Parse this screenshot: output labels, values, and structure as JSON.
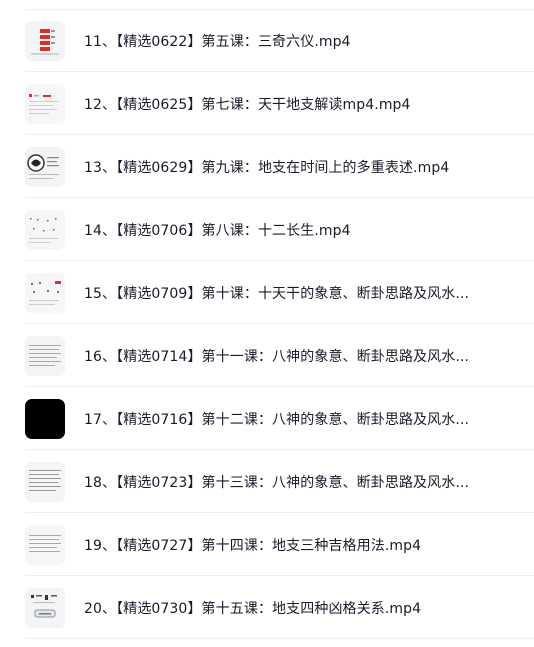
{
  "files": [
    {
      "title": "11、【精选0622】第五课：三奇六仪.mp4",
      "icon": "video-thumbnail"
    },
    {
      "title": "12、【精选0625】第七课：天干地支解读mp4.mp4",
      "icon": "video-thumbnail"
    },
    {
      "title": "13、【精选0629】第九课：地支在时间上的多重表述.mp4",
      "icon": "video-thumbnail"
    },
    {
      "title": "14、【精选0706】第八课：十二长生.mp4",
      "icon": "video-thumbnail"
    },
    {
      "title": "15、【精选0709】第十课：十天干的象意、断卦思路及风水...",
      "icon": "video-thumbnail"
    },
    {
      "title": "16、【精选0714】第十一课：八神的象意、断卦思路及风水...",
      "icon": "video-thumbnail"
    },
    {
      "title": "17、【精选0716】第十二课：八神的象意、断卦思路及风水...",
      "icon": "video-thumbnail-black"
    },
    {
      "title": "18、【精选0723】第十三课：八神的象意、断卦思路及风水...",
      "icon": "video-thumbnail"
    },
    {
      "title": "19、【精选0727】第十四课：地支三种吉格用法.mp4",
      "icon": "video-thumbnail"
    },
    {
      "title": "20、【精选0730】第十五课：地支四种凶格关系.mp4",
      "icon": "video-thumbnail"
    }
  ],
  "colors": {
    "text": "#1a1a2a",
    "divider": "#ececf1",
    "accent_red": "#d9302c"
  }
}
